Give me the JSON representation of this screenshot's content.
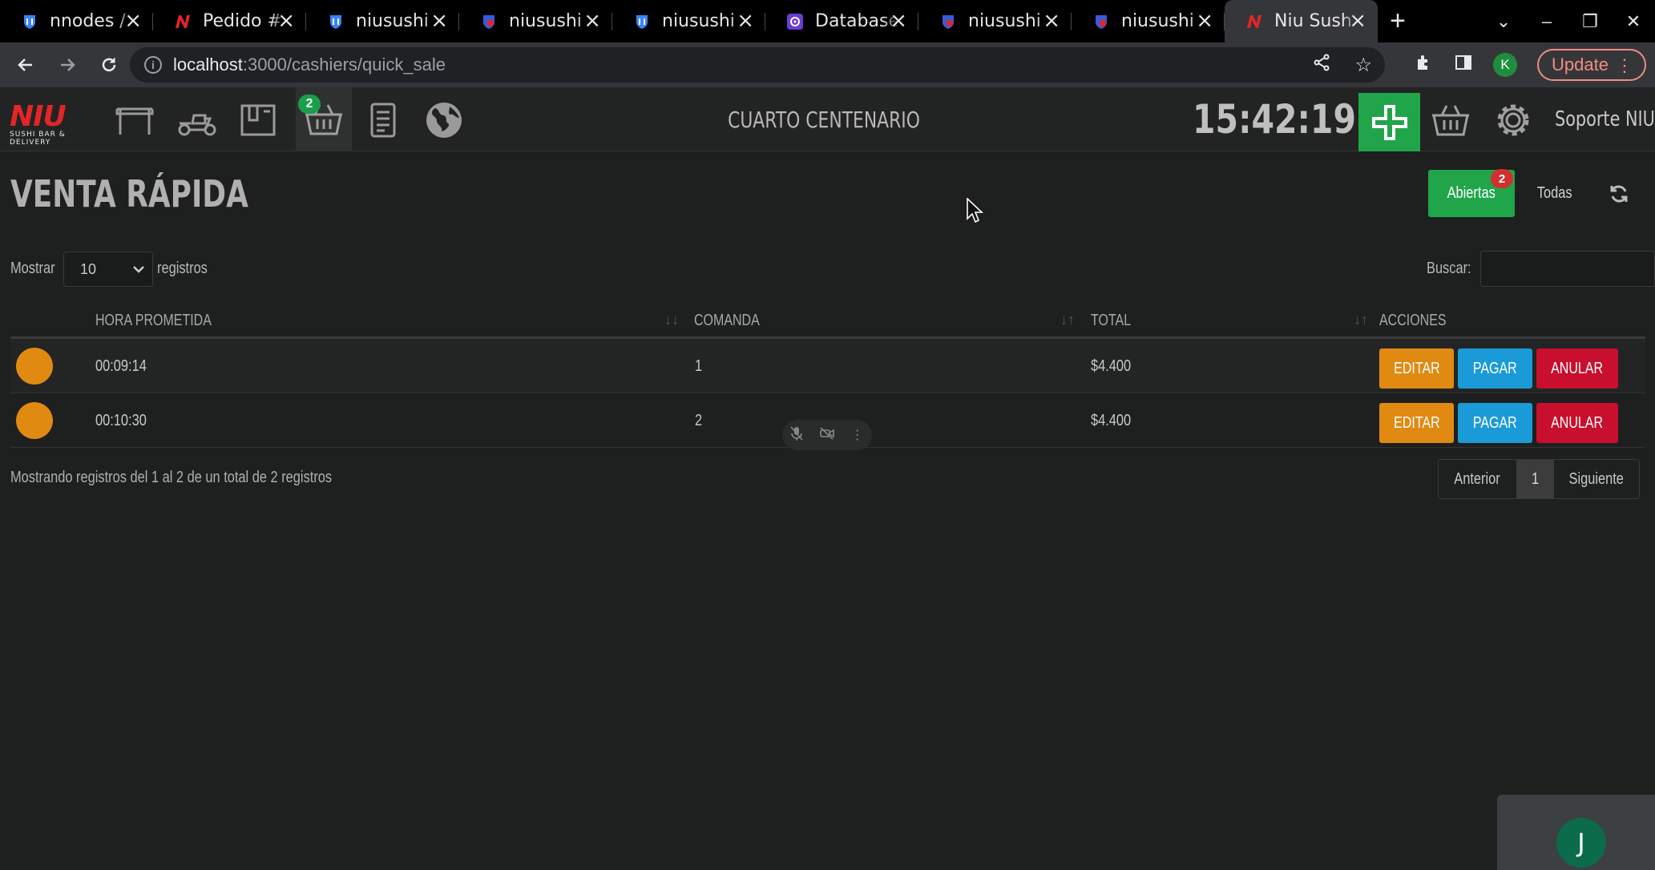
{
  "browser": {
    "tabs": [
      {
        "title": "nnodes /",
        "favicon": "blue-shield-icon",
        "active": false
      },
      {
        "title": "Pedido #",
        "favicon": "niu-logo-icon",
        "active": false
      },
      {
        "title": "niusushi",
        "favicon": "blue-shield-icon",
        "active": false
      },
      {
        "title": "niusushi",
        "favicon": "blue-shield-icon",
        "active": false
      },
      {
        "title": "niusushi",
        "favicon": "blue-shield-icon",
        "active": false
      },
      {
        "title": "Database",
        "favicon": "purple-database-icon",
        "active": false
      },
      {
        "title": "niusushi",
        "favicon": "blue-shield-icon",
        "active": false
      },
      {
        "title": "niusushi",
        "favicon": "blue-shield-icon",
        "active": false
      },
      {
        "title": "Niu Sush",
        "favicon": "niu-logo-icon",
        "active": true
      }
    ],
    "url_host": "localhost",
    "url_path": ":3000/cashiers/quick_sale",
    "profile_initial": "K",
    "update_label": "Update"
  },
  "app": {
    "logo_text": "NIU",
    "logo_subtext": "SUSHI BAR & DELIVERY",
    "basket_badge": "2",
    "branch": "CUARTO CENTENARIO",
    "clock": "15:42:19",
    "user_menu": "Soporte NIU"
  },
  "page": {
    "title": "VENTA RÁPIDA",
    "filters": {
      "open_label": "Abiertas",
      "open_count": "2",
      "all_label": "Todas"
    },
    "length": {
      "prefix": "Mostrar",
      "value": "10",
      "suffix": "registros"
    },
    "search": {
      "label": "Buscar:",
      "value": ""
    },
    "table": {
      "headers": [
        "HORA PROMETIDA",
        "COMANDA",
        "TOTAL",
        "ACCIONES"
      ],
      "rows": [
        {
          "hora": "00:09:14",
          "comanda": "1",
          "total": "$4.400"
        },
        {
          "hora": "00:10:30",
          "comanda": "2",
          "total": "$4.400"
        }
      ],
      "actions": {
        "edit": "EDITAR",
        "pay": "PAGAR",
        "cancel": "ANULAR"
      }
    },
    "info": "Mostrando registros del 1 al 2 de un total de 2 registros",
    "pager": {
      "prev": "Anterior",
      "current": "1",
      "next": "Siguiente"
    }
  },
  "meet": {
    "avatar_initial": "J"
  },
  "colors": {
    "brand_red": "#e32528",
    "success_green": "#21a54a",
    "warning_orange": "#e08a12",
    "info_blue": "#1a9bd7",
    "danger_red": "#c80f2e"
  }
}
